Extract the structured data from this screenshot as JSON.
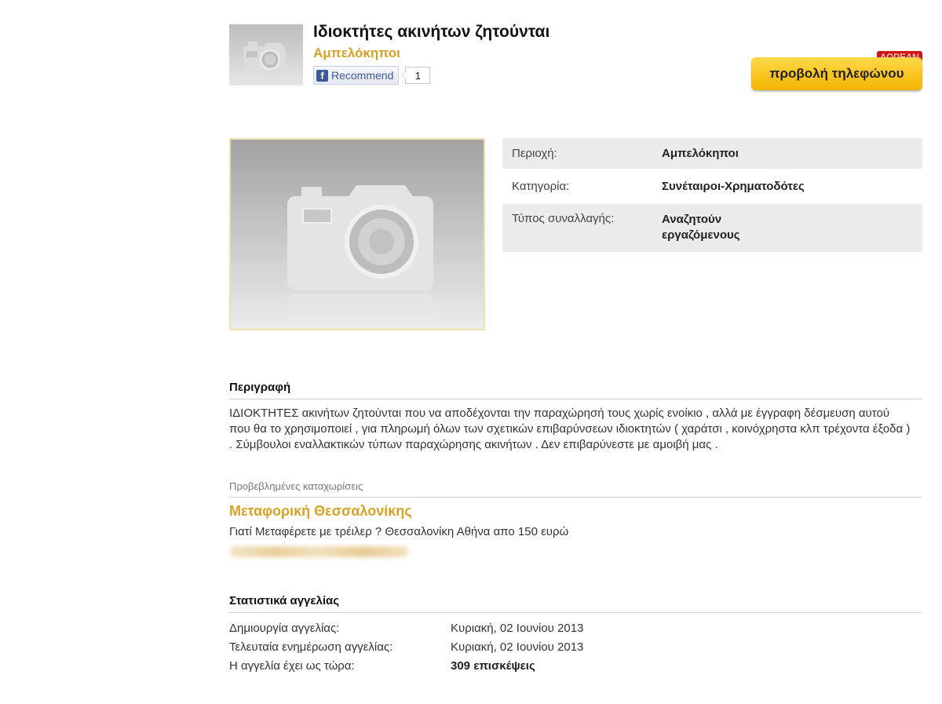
{
  "listing": {
    "title": "Ιδιοκτήτες ακινήτων ζητούνται",
    "location": "Αμπελόκηποι",
    "fb_label": "Recommend",
    "fb_count": "1",
    "free_badge": "ΔΩΡΕΑΝ",
    "phone_button": "προβολή τηλεφώνου"
  },
  "details": [
    {
      "label": "Περιοχή:",
      "value": "Αμπελόκηποι"
    },
    {
      "label": "Κατηγορία:",
      "value": "Συνέταιροι-Χρηματοδότες"
    },
    {
      "label": "Τύπος συναλλαγής:",
      "value": "Αναζητούν εργαζόμενους"
    }
  ],
  "description": {
    "heading": "Περιγραφή",
    "text": "ΙΔΙΟΚΤΗΤΕΣ ακινήτων ζητούνται που να αποδέχονται την παραχώρησή τους χωρίς ενοίκιο , αλλά με έγγραφη δέσμευση αυτού που θα το χρησιμοποιεί , για πληρωμή όλων των σχετικών επιβαρύνσεων ιδιοκτητών ( χαράτσι , κοινόχρηστα κλπ τρέχοντα έξοδα ) . Σύμβουλοι εναλλακτικών τύπων παραχώρησης ακινήτων . Δεν επιβαρύνεστε με αμοιβή μας ."
  },
  "promoted": {
    "heading": "Προβεβλημένες καταχωρίσεις",
    "title": "Μεταφορική Θεσσαλονίκης",
    "text": "Γιατί Μεταφέρετε με τρέιλερ ? Θεσσαλονίκη Αθήνα απο 150 ευρώ"
  },
  "stats": {
    "heading": "Στατιστικά αγγελίας",
    "rows": [
      {
        "label": "Δημιουργία αγγελίας:",
        "value": "Κυριακή, 02 Ιουνίου 2013"
      },
      {
        "label": "Τελευταία ενημέρωση αγγελίας:",
        "value": "Κυριακή, 02 Ιουνίου 2013"
      },
      {
        "label": "Η αγγελία έχει ως τώρα:",
        "value": "309 επισκέψεις"
      }
    ]
  },
  "colors": {
    "accent": "#d7a125",
    "button": "#f5b400",
    "badge": "#d11919"
  }
}
